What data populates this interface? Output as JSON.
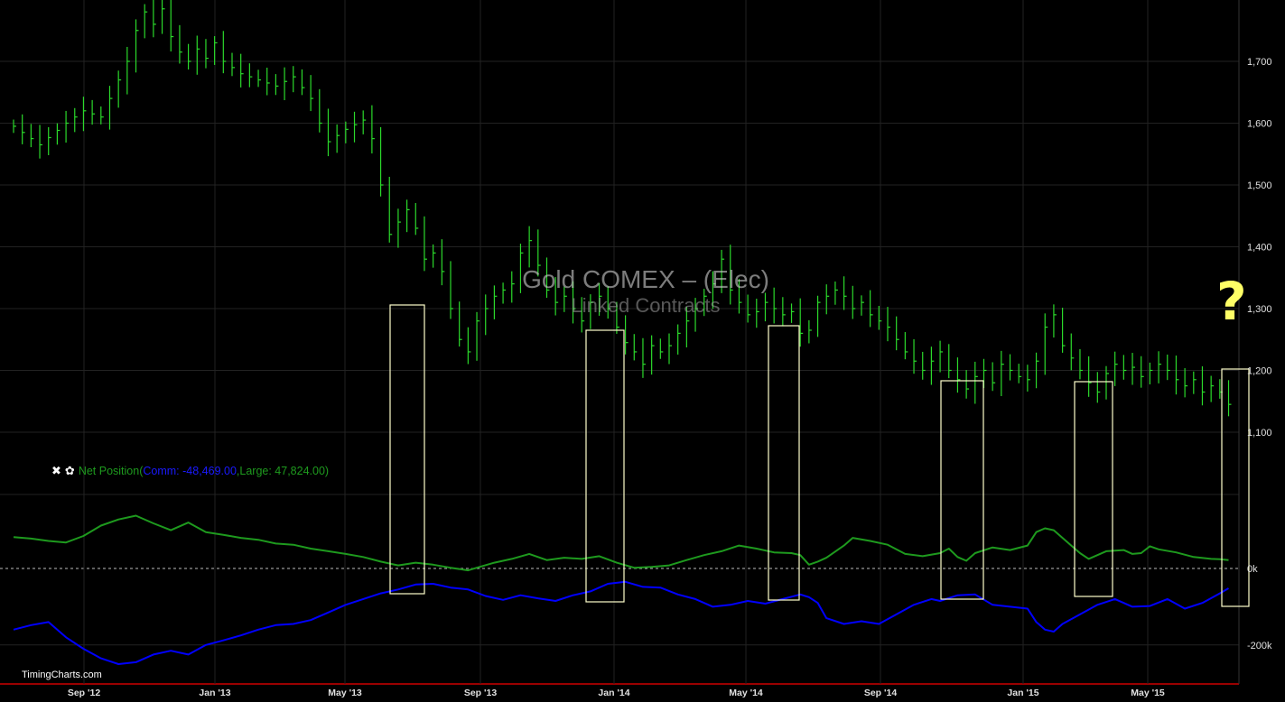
{
  "chart_data": {
    "type": "ohlc",
    "title": "Gold COMEX – (Elec)",
    "subtitle": "Linked Contracts",
    "price_axis": {
      "ticks": [
        "1,700",
        "1,600",
        "1,500",
        "1,400",
        "1,300",
        "1,200",
        "1,100"
      ],
      "range": [
        1020,
        1800
      ]
    },
    "position_axis": {
      "ticks": [
        "0k",
        "-200k"
      ],
      "range": [
        -280000,
        200000
      ]
    },
    "x_ticks": [
      "Sep '12",
      "Jan '13",
      "May '13",
      "Sep '13",
      "Jan '14",
      "May '14",
      "Sep '14",
      "Jan '15",
      "May '15"
    ],
    "grid": true,
    "price_points": [
      [
        0,
        1595
      ],
      [
        3,
        1565
      ],
      [
        6,
        1600
      ],
      [
        8,
        1620
      ],
      [
        10,
        1610
      ],
      [
        12,
        1670
      ],
      [
        13,
        1700
      ],
      [
        14,
        1750
      ],
      [
        15,
        1780
      ],
      [
        16,
        1760
      ],
      [
        17,
        1785
      ],
      [
        18,
        1740
      ],
      [
        19,
        1715
      ],
      [
        20,
        1700
      ],
      [
        21,
        1720
      ],
      [
        22,
        1705
      ],
      [
        23,
        1730
      ],
      [
        24,
        1700
      ],
      [
        26,
        1680
      ],
      [
        28,
        1670
      ],
      [
        30,
        1660
      ],
      [
        32,
        1675
      ],
      [
        34,
        1640
      ],
      [
        35,
        1600
      ],
      [
        36,
        1570
      ],
      [
        38,
        1590
      ],
      [
        40,
        1605
      ],
      [
        41,
        1575
      ],
      [
        42,
        1500
      ],
      [
        43,
        1420
      ],
      [
        44,
        1440
      ],
      [
        45,
        1460
      ],
      [
        46,
        1430
      ],
      [
        47,
        1380
      ],
      [
        48,
        1390
      ],
      [
        49,
        1360
      ],
      [
        50,
        1300
      ],
      [
        51,
        1250
      ],
      [
        52,
        1230
      ],
      [
        53,
        1280
      ],
      [
        54,
        1300
      ],
      [
        55,
        1320
      ],
      [
        56,
        1330
      ],
      [
        57,
        1340
      ],
      [
        58,
        1390
      ],
      [
        59,
        1410
      ],
      [
        60,
        1370
      ],
      [
        61,
        1330
      ],
      [
        62,
        1310
      ],
      [
        63,
        1320
      ],
      [
        64,
        1300
      ],
      [
        65,
        1280
      ],
      [
        66,
        1310
      ],
      [
        67,
        1320
      ],
      [
        68,
        1300
      ],
      [
        69,
        1270
      ],
      [
        70,
        1245
      ],
      [
        71,
        1230
      ],
      [
        72,
        1210
      ],
      [
        73,
        1240
      ],
      [
        74,
        1230
      ],
      [
        75,
        1240
      ],
      [
        76,
        1260
      ],
      [
        77,
        1280
      ],
      [
        78,
        1300
      ],
      [
        79,
        1320
      ],
      [
        80,
        1340
      ],
      [
        81,
        1380
      ],
      [
        82,
        1330
      ],
      [
        83,
        1310
      ],
      [
        84,
        1290
      ],
      [
        85,
        1295
      ],
      [
        86,
        1310
      ],
      [
        87,
        1300
      ],
      [
        88,
        1290
      ],
      [
        89,
        1295
      ],
      [
        90,
        1260
      ],
      [
        91,
        1265
      ],
      [
        92,
        1310
      ],
      [
        93,
        1320
      ],
      [
        94,
        1330
      ],
      [
        95,
        1320
      ],
      [
        96,
        1300
      ],
      [
        97,
        1310
      ],
      [
        98,
        1290
      ],
      [
        99,
        1280
      ],
      [
        100,
        1270
      ],
      [
        101,
        1250
      ],
      [
        102,
        1230
      ],
      [
        103,
        1215
      ],
      [
        104,
        1200
      ],
      [
        105,
        1215
      ],
      [
        106,
        1230
      ],
      [
        107,
        1200
      ],
      [
        108,
        1185
      ],
      [
        109,
        1170
      ],
      [
        110,
        1190
      ],
      [
        111,
        1200
      ],
      [
        112,
        1180
      ],
      [
        113,
        1210
      ],
      [
        114,
        1200
      ],
      [
        115,
        1190
      ],
      [
        116,
        1185
      ],
      [
        117,
        1215
      ],
      [
        118,
        1270
      ],
      [
        119,
        1290
      ],
      [
        120,
        1240
      ],
      [
        121,
        1220
      ],
      [
        122,
        1200
      ],
      [
        123,
        1180
      ],
      [
        124,
        1165
      ],
      [
        125,
        1195
      ],
      [
        126,
        1210
      ],
      [
        127,
        1200
      ],
      [
        128,
        1205
      ],
      [
        129,
        1190
      ],
      [
        130,
        1200
      ],
      [
        131,
        1210
      ],
      [
        132,
        1200
      ],
      [
        133,
        1185
      ],
      [
        134,
        1175
      ],
      [
        135,
        1185
      ],
      [
        136,
        1165
      ],
      [
        137,
        1175
      ],
      [
        138,
        1165
      ],
      [
        139,
        1145
      ]
    ],
    "series": [
      {
        "color": "#1e9a1e",
        "values": [
          [
            0,
            82000
          ],
          [
            2,
            78000
          ],
          [
            4,
            72000
          ],
          [
            6,
            68000
          ],
          [
            8,
            85000
          ],
          [
            10,
            112000
          ],
          [
            12,
            128000
          ],
          [
            14,
            138000
          ],
          [
            16,
            118000
          ],
          [
            18,
            100000
          ],
          [
            20,
            120000
          ],
          [
            22,
            95000
          ],
          [
            24,
            88000
          ],
          [
            26,
            80000
          ],
          [
            28,
            75000
          ],
          [
            30,
            65000
          ],
          [
            32,
            62000
          ],
          [
            34,
            52000
          ],
          [
            36,
            45000
          ],
          [
            38,
            38000
          ],
          [
            40,
            30000
          ],
          [
            42,
            18000
          ],
          [
            44,
            8000
          ],
          [
            46,
            15000
          ],
          [
            48,
            10000
          ],
          [
            50,
            2000
          ],
          [
            52,
            -5000
          ],
          [
            53,
            2000
          ],
          [
            55,
            15000
          ],
          [
            57,
            25000
          ],
          [
            59,
            38000
          ],
          [
            61,
            22000
          ],
          [
            63,
            28000
          ],
          [
            65,
            25000
          ],
          [
            67,
            32000
          ],
          [
            69,
            15000
          ],
          [
            71,
            2000
          ],
          [
            73,
            4000
          ],
          [
            75,
            8000
          ],
          [
            77,
            22000
          ],
          [
            79,
            35000
          ],
          [
            81,
            45000
          ],
          [
            83,
            60000
          ],
          [
            85,
            52000
          ],
          [
            87,
            42000
          ],
          [
            89,
            40000
          ],
          [
            90,
            35000
          ],
          [
            91,
            10000
          ],
          [
            92,
            18000
          ],
          [
            93,
            28000
          ],
          [
            95,
            60000
          ],
          [
            96,
            80000
          ],
          [
            98,
            72000
          ],
          [
            100,
            62000
          ],
          [
            102,
            38000
          ],
          [
            104,
            32000
          ],
          [
            106,
            40000
          ],
          [
            107,
            52000
          ],
          [
            108,
            30000
          ],
          [
            109,
            20000
          ],
          [
            110,
            40000
          ],
          [
            112,
            55000
          ],
          [
            114,
            48000
          ],
          [
            116,
            60000
          ],
          [
            117,
            95000
          ],
          [
            118,
            105000
          ],
          [
            119,
            100000
          ],
          [
            120,
            80000
          ],
          [
            121,
            60000
          ],
          [
            122,
            40000
          ],
          [
            123,
            25000
          ],
          [
            124,
            35000
          ],
          [
            125,
            45000
          ],
          [
            127,
            48000
          ],
          [
            128,
            38000
          ],
          [
            129,
            40000
          ],
          [
            130,
            58000
          ],
          [
            131,
            50000
          ],
          [
            133,
            42000
          ],
          [
            135,
            30000
          ],
          [
            137,
            25000
          ],
          [
            138,
            24000
          ],
          [
            139,
            22000
          ]
        ]
      },
      {
        "color": "#0000ff",
        "values": [
          [
            0,
            -160000
          ],
          [
            2,
            -148000
          ],
          [
            4,
            -140000
          ],
          [
            6,
            -180000
          ],
          [
            8,
            -210000
          ],
          [
            10,
            -235000
          ],
          [
            12,
            -250000
          ],
          [
            14,
            -245000
          ],
          [
            16,
            -225000
          ],
          [
            18,
            -215000
          ],
          [
            20,
            -225000
          ],
          [
            22,
            -200000
          ],
          [
            24,
            -188000
          ],
          [
            26,
            -175000
          ],
          [
            28,
            -160000
          ],
          [
            30,
            -148000
          ],
          [
            32,
            -145000
          ],
          [
            34,
            -135000
          ],
          [
            36,
            -115000
          ],
          [
            38,
            -95000
          ],
          [
            40,
            -80000
          ],
          [
            42,
            -65000
          ],
          [
            44,
            -55000
          ],
          [
            46,
            -42000
          ],
          [
            48,
            -40000
          ],
          [
            50,
            -50000
          ],
          [
            52,
            -55000
          ],
          [
            54,
            -72000
          ],
          [
            56,
            -82000
          ],
          [
            58,
            -70000
          ],
          [
            60,
            -78000
          ],
          [
            62,
            -85000
          ],
          [
            64,
            -70000
          ],
          [
            66,
            -60000
          ],
          [
            68,
            -40000
          ],
          [
            70,
            -35000
          ],
          [
            72,
            -48000
          ],
          [
            74,
            -50000
          ],
          [
            76,
            -68000
          ],
          [
            78,
            -80000
          ],
          [
            80,
            -100000
          ],
          [
            82,
            -95000
          ],
          [
            84,
            -85000
          ],
          [
            86,
            -92000
          ],
          [
            88,
            -80000
          ],
          [
            90,
            -68000
          ],
          [
            91,
            -75000
          ],
          [
            92,
            -90000
          ],
          [
            93,
            -130000
          ],
          [
            95,
            -145000
          ],
          [
            97,
            -138000
          ],
          [
            99,
            -145000
          ],
          [
            101,
            -120000
          ],
          [
            103,
            -95000
          ],
          [
            105,
            -80000
          ],
          [
            106,
            -85000
          ],
          [
            108,
            -70000
          ],
          [
            110,
            -68000
          ],
          [
            112,
            -95000
          ],
          [
            114,
            -100000
          ],
          [
            116,
            -105000
          ],
          [
            117,
            -140000
          ],
          [
            118,
            -160000
          ],
          [
            119,
            -165000
          ],
          [
            120,
            -145000
          ],
          [
            122,
            -120000
          ],
          [
            124,
            -95000
          ],
          [
            126,
            -80000
          ],
          [
            128,
            -100000
          ],
          [
            130,
            -98000
          ],
          [
            132,
            -80000
          ],
          [
            134,
            -105000
          ],
          [
            136,
            -90000
          ],
          [
            138,
            -65000
          ],
          [
            139,
            -52000
          ]
        ]
      }
    ],
    "highlight_boxes": [
      [
        48,
        51
      ],
      [
        72,
        76
      ],
      [
        95,
        98
      ],
      [
        116,
        121
      ],
      [
        133,
        137
      ],
      [
        151,
        154
      ]
    ]
  },
  "legend": {
    "close_icon": "✖",
    "settings_icon": "✿",
    "label": "Net Position(",
    "comm": "Comm: -48,469.00",
    "comma": ",",
    "large": "Large: 47,824.00)"
  },
  "annotation": "?",
  "brand": "TimingCharts.com",
  "colors": {
    "price": "#2bd92b",
    "net_large": "#1e9a1e",
    "net_comm": "#0000ff",
    "grid": "#222222",
    "box": "#ffffcc",
    "axis": "#cc0000"
  }
}
